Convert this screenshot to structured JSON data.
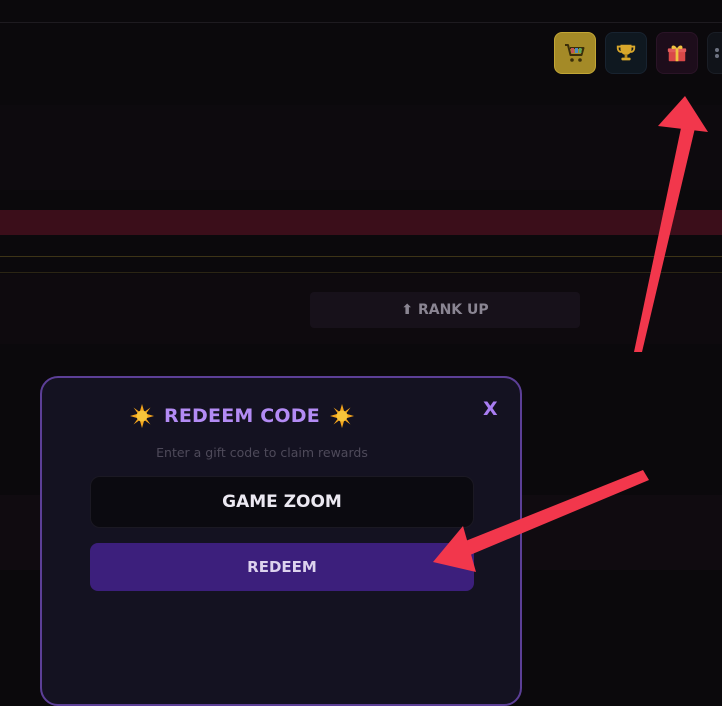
{
  "topbar": {
    "icons": [
      "shop-cart-icon",
      "trophy-icon",
      "gift-icon",
      "menu-icon"
    ]
  },
  "rank": {
    "label": "⬆ RANK UP"
  },
  "modal": {
    "title": "REDEEM CODE",
    "title_icon": "sun-icon",
    "close_label": "X",
    "subtitle": "Enter a gift code to claim rewards",
    "code_value": "GAME ZOOM",
    "redeem_label": "REDEEM"
  },
  "colors": {
    "accent": "#b38bf4",
    "modal_border": "#5c3f97",
    "redeem_button": "#3c1f7c",
    "annotation_arrow": "#f2374c",
    "shop_button": "#a48a27"
  }
}
